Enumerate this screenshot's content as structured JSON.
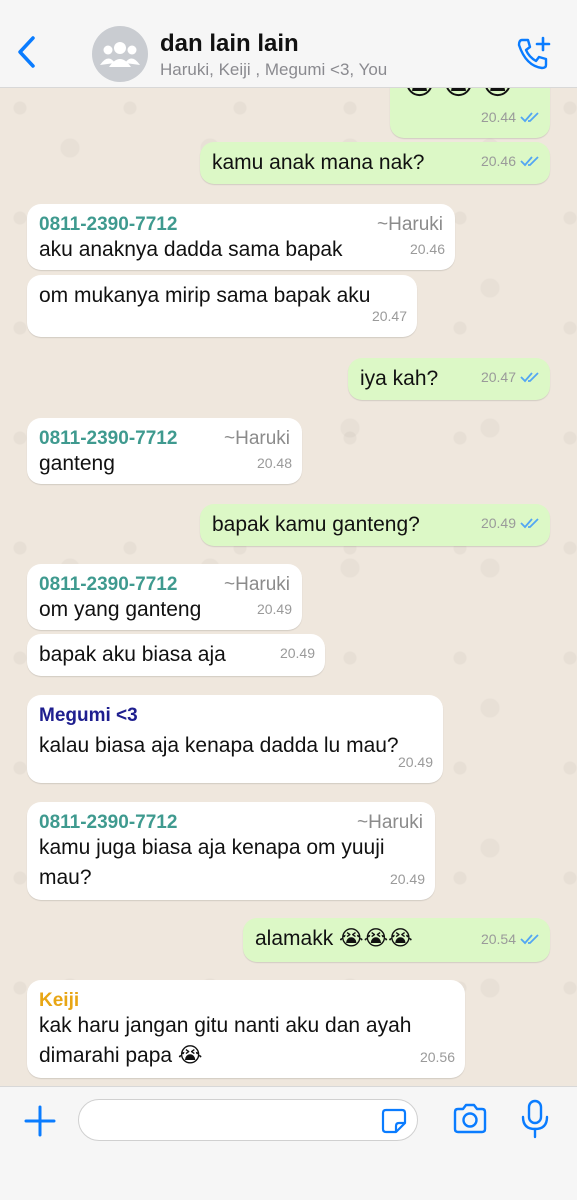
{
  "header": {
    "title": "dan lain lain",
    "subtitle": "Haruki, Keiji , Megumi <3, You"
  },
  "messages": [
    {
      "text": "😭😭😭",
      "time": "20.44"
    },
    {
      "text": "kamu anak mana nak?",
      "time": "20.46"
    },
    {
      "sender": "0811-2390-7712",
      "alias": "~Haruki",
      "text": "aku anaknya dadda sama bapak",
      "time": "20.46"
    },
    {
      "text": "om mukanya mirip sama bapak aku",
      "time": "20.47"
    },
    {
      "text": "iya kah?",
      "time": "20.47"
    },
    {
      "sender": "0811-2390-7712",
      "alias": "~Haruki",
      "text": "ganteng",
      "time": "20.48"
    },
    {
      "text": "bapak kamu ganteng?",
      "time": "20.49"
    },
    {
      "sender": "0811-2390-7712",
      "alias": "~Haruki",
      "text": "om yang ganteng",
      "time": "20.49"
    },
    {
      "text": "bapak aku biasa aja",
      "time": "20.49"
    },
    {
      "sender": "Megumi <3",
      "text": "kalau biasa aja kenapa dadda lu mau?",
      "time": "20.49"
    },
    {
      "sender": "0811-2390-7712",
      "alias": "~Haruki",
      "text_line1": "kamu juga biasa aja kenapa om yuuji",
      "text_line2": "mau?",
      "time": "20.49"
    },
    {
      "text": "alamakk 😭😭😭",
      "time": "20.54"
    },
    {
      "sender": "Keiji",
      "text_line1": "kak haru jangan gitu nanti aku dan ayah",
      "text_line2": "dimarahi papa 😭",
      "time": "20.56"
    }
  ],
  "colors": {
    "accent": "#0a7cff",
    "outgoing_bubble": "#dcf8c6",
    "incoming_bubble": "#ffffff",
    "sender_phone": "#3f9a8f",
    "sender_megumi": "#1f1f8f",
    "sender_keiji": "#e8a614",
    "read_ticks": "#53a6f3"
  },
  "icons": [
    "back-chevron-icon",
    "group-avatar-icon",
    "add-call-icon",
    "read-ticks-icon",
    "plus-icon",
    "sticker-icon",
    "camera-icon",
    "microphone-icon"
  ]
}
